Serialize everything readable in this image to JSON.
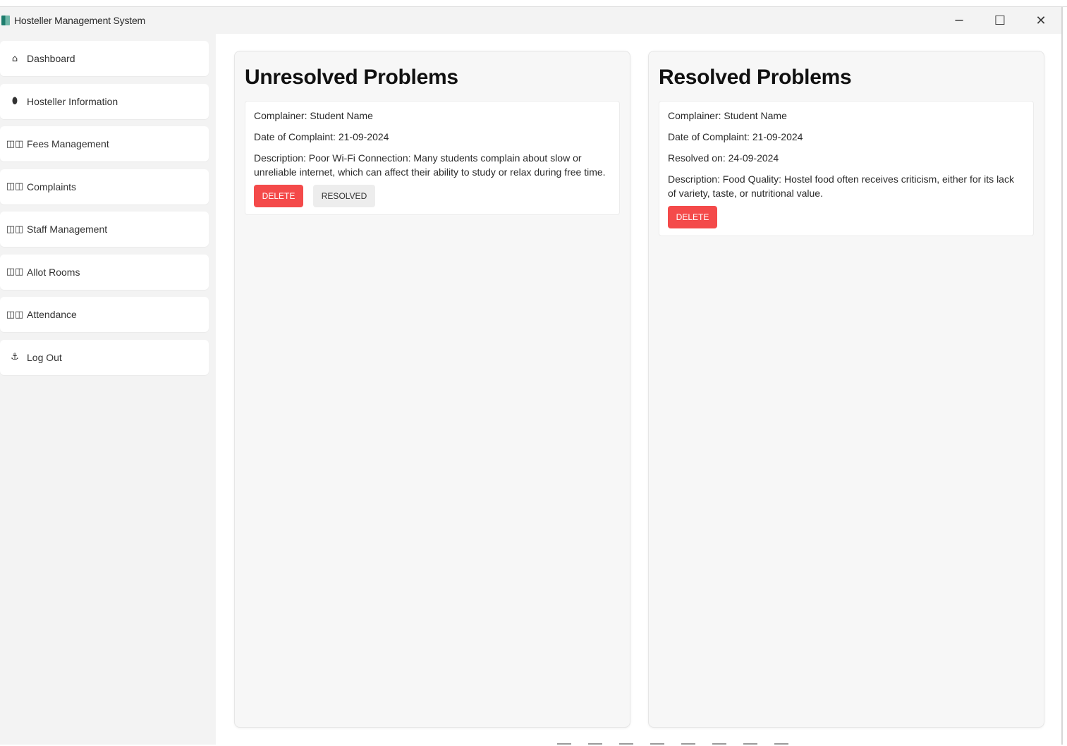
{
  "window": {
    "title": "Hosteller Management System",
    "controls": {
      "minimize": "─",
      "maximize": "☐",
      "close": "✕"
    }
  },
  "sidebar": {
    "items": [
      {
        "label": "Dashboard",
        "icon": "home-icon",
        "glyph": "⌂"
      },
      {
        "label": "Hosteller Information",
        "icon": "person-icon",
        "glyph": "⬮"
      },
      {
        "label": "Fees Management",
        "icon": "grid-icon",
        "glyph": "◫◫"
      },
      {
        "label": "Complaints",
        "icon": "grid-icon",
        "glyph": "◫◫"
      },
      {
        "label": "Staff Management",
        "icon": "grid-icon",
        "glyph": "◫◫"
      },
      {
        "label": "Allot Rooms",
        "icon": "grid-icon",
        "glyph": "◫◫"
      },
      {
        "label": "Attendance",
        "icon": "grid-icon",
        "glyph": "◫◫"
      },
      {
        "label": "Log Out",
        "icon": "logout-icon",
        "glyph": "⚓"
      }
    ]
  },
  "unresolved": {
    "title": "Unresolved Problems",
    "card": {
      "student": "Complainer: Student Name",
      "date": "Date of Complaint: 21-09-2024",
      "description": "Description: Poor Wi-Fi Connection: Many students complain about slow or unreliable internet, which can affect their ability to study or relax during free time.",
      "delete_label": "DELETE",
      "resolved_label": "RESOLVED"
    }
  },
  "resolved": {
    "title": "Resolved Problems",
    "card": {
      "student": "Complainer: Student Name",
      "date": "Date of Complaint: 21-09-2024",
      "resolved_on": "Resolved on: 24-09-2024",
      "description": "Description: Food Quality: Hostel food often receives criticism, either for its lack of variety, taste, or nutritional value.",
      "delete_label": "DELETE"
    }
  },
  "colors": {
    "delete": "#f44a4a",
    "sidebar_bg": "#f3f3f3",
    "panel_bg": "#f7f7f7"
  }
}
